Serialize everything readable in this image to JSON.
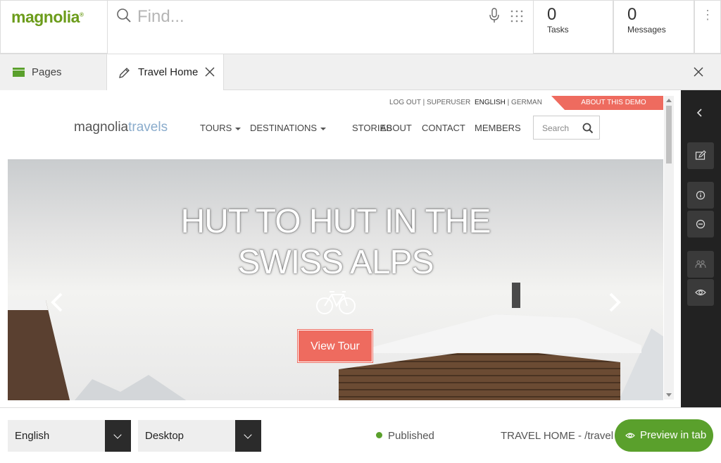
{
  "app": {
    "logo": "magnolia",
    "search_placeholder": "Find...",
    "tasks": {
      "count": "0",
      "label": "Tasks"
    },
    "messages": {
      "count": "0",
      "label": "Messages"
    }
  },
  "tabs": {
    "pages_label": "Pages",
    "active_label": "Travel Home"
  },
  "site": {
    "logout": "LOG OUT | SUPERUSER",
    "lang_active": "ENGLISH",
    "lang_other": " | GERMAN",
    "about_demo": "ABOUT THIS DEMO",
    "logo_main": "magnolia",
    "logo_accent": "travels",
    "nav": [
      "TOURS",
      "DESTINATIONS",
      "STORIES",
      "ABOUT",
      "CONTACT",
      "MEMBERS"
    ],
    "search_placeholder": "Search",
    "hero_line1": "HUT TO HUT IN THE",
    "hero_line2": "SWISS ALPS",
    "hero_button": "View Tour"
  },
  "bottom": {
    "language": "English",
    "device": "Desktop",
    "status": "Published",
    "status_color": "#5aa02c",
    "path": "TRAVEL HOME - /travel",
    "preview_button": "Preview in tab"
  },
  "colors": {
    "brand_green": "#6c9c1b",
    "accent_green": "#5aa02c",
    "demo_coral": "#ee6b5f",
    "sidebar_dark": "#222222"
  },
  "icons": {
    "right_sidebar": [
      "chevron-left-icon",
      "edit-note-icon",
      "info-icon",
      "minus-circle-icon",
      "users-icon",
      "eye-icon"
    ]
  }
}
